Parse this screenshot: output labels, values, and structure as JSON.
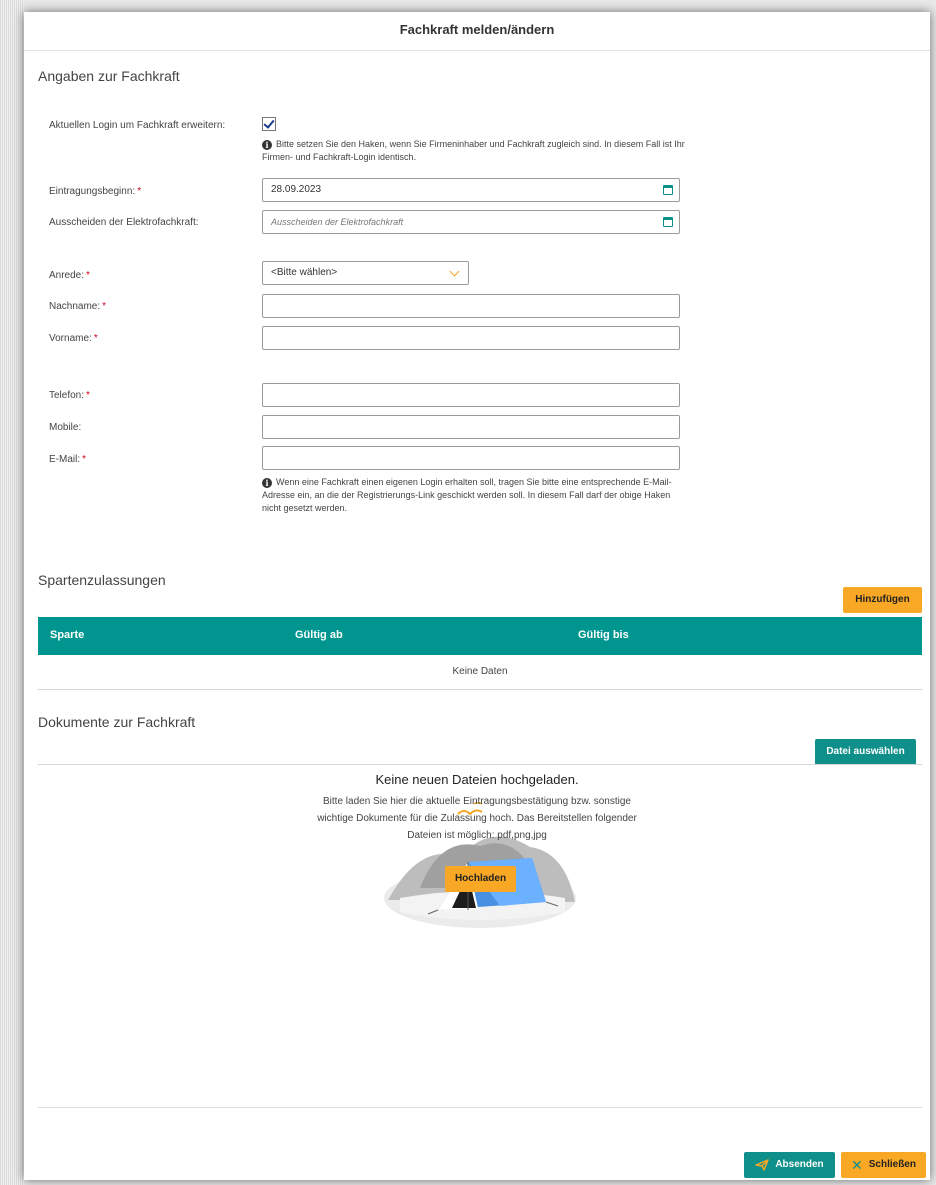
{
  "dialog": {
    "title": "Fachkraft melden/ändern"
  },
  "section_fachkraft": {
    "title": "Angaben zur Fachkraft",
    "login_label": "Aktuellen Login um Fachkraft erweitern:",
    "login_checked": true,
    "login_hint": "Bitte setzen Sie den Haken, wenn Sie Firmeninhaber und Fachkraft zugleich sind. In diesem Fall ist Ihr Firmen- und Fachkraft-Login identisch.",
    "eintragungsbeginn_label": "Eintragungsbeginn:",
    "eintragungsbeginn_value": "28.09.2023",
    "ausscheiden_label": "Ausscheiden der Elektrofachkraft:",
    "ausscheiden_placeholder": "Ausscheiden der Elektrofachkraft",
    "anrede_label": "Anrede:",
    "anrede_value": "<Bitte wählen>",
    "nachname_label": "Nachname:",
    "nachname_value": "",
    "vorname_label": "Vorname:",
    "vorname_value": "",
    "telefon_label": "Telefon:",
    "telefon_value": "",
    "mobile_label": "Mobile:",
    "mobile_value": "",
    "email_label": "E-Mail:",
    "email_value": "",
    "email_hint": "Wenn eine Fachkraft einen eigenen Login erhalten soll, tragen Sie bitte eine entsprechende E-Mail-Adresse ein, an die der Registrierungs-Link geschickt werden soll. In diesem Fall darf der obige Haken nicht gesetzt werden.",
    "required_marker": "*"
  },
  "section_sparten": {
    "title": "Spartenzulassungen",
    "add_button": "Hinzufügen",
    "columns": [
      "Sparte",
      "Gültig ab",
      "Gültig bis"
    ],
    "empty_text": "Keine Daten"
  },
  "section_dokumente": {
    "title": "Dokumente zur Fachkraft",
    "choose_button": "Datei auswählen",
    "empty_title": "Keine neuen Dateien hochgeladen.",
    "empty_desc": "Bitte laden Sie hier die aktuelle Eintragungsbestätigung bzw. sonstige wichtige Dokumente für die Zulassung hoch. Das Bereitstellen folgender Dateien ist möglich: pdf,png,jpg",
    "upload_button": "Hochladen"
  },
  "footer": {
    "submit_button": "Absenden",
    "close_button": "Schließen"
  },
  "colors": {
    "teal": "#00968f",
    "orange": "#f9a825",
    "required": "#d0021b"
  }
}
